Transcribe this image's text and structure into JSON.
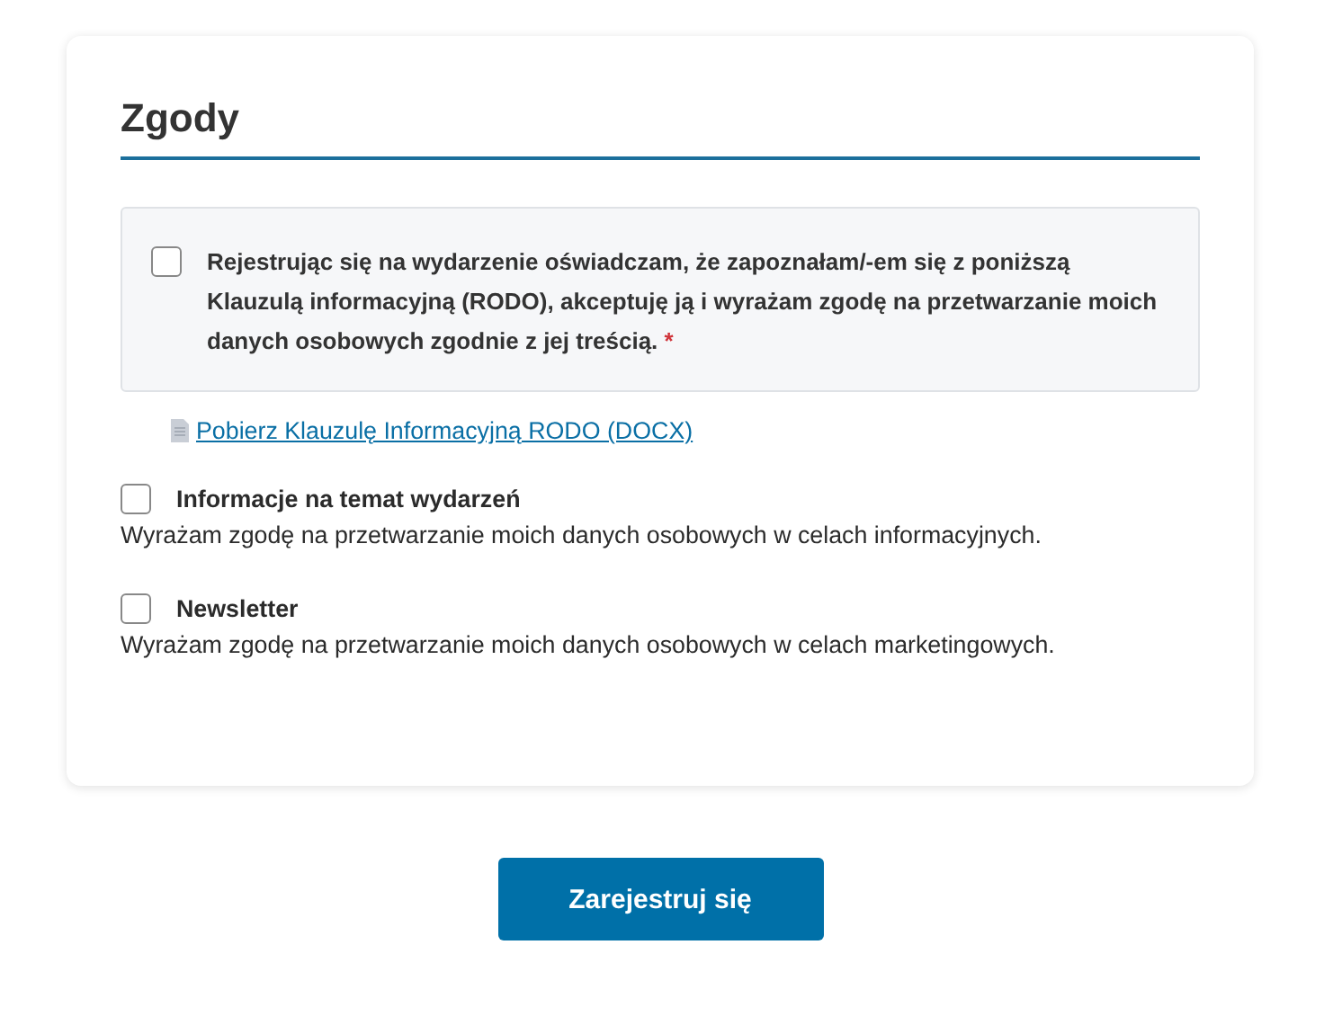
{
  "section": {
    "title": "Zgody"
  },
  "consents": [
    {
      "kind": "boxed",
      "checked": false,
      "text": "Rejestrując się na wydarzenie oświadczam, że zapoznałam/-em się z poniższą Klauzulą informacyjną (RODO), akceptuję ją i wyrażam zgodę na przetwarzanie moich danych osobowych zgodnie z jej treścią.",
      "required_mark": "*"
    },
    {
      "kind": "link",
      "text": "Pobierz Klauzulę Informacyjną RODO (DOCX)"
    },
    {
      "kind": "option",
      "checked": false,
      "title": "Informacje na temat wydarzeń",
      "text": "Wyrażam zgodę na przetwarzanie moich danych osobowych w celach informacyjnych."
    },
    {
      "kind": "option",
      "checked": false,
      "title": "Newsletter",
      "text": "Wyrażam zgodę na przetwarzanie moich danych osobowych w celach marketingowych."
    }
  ],
  "submit_button": "Zarejestruj się"
}
